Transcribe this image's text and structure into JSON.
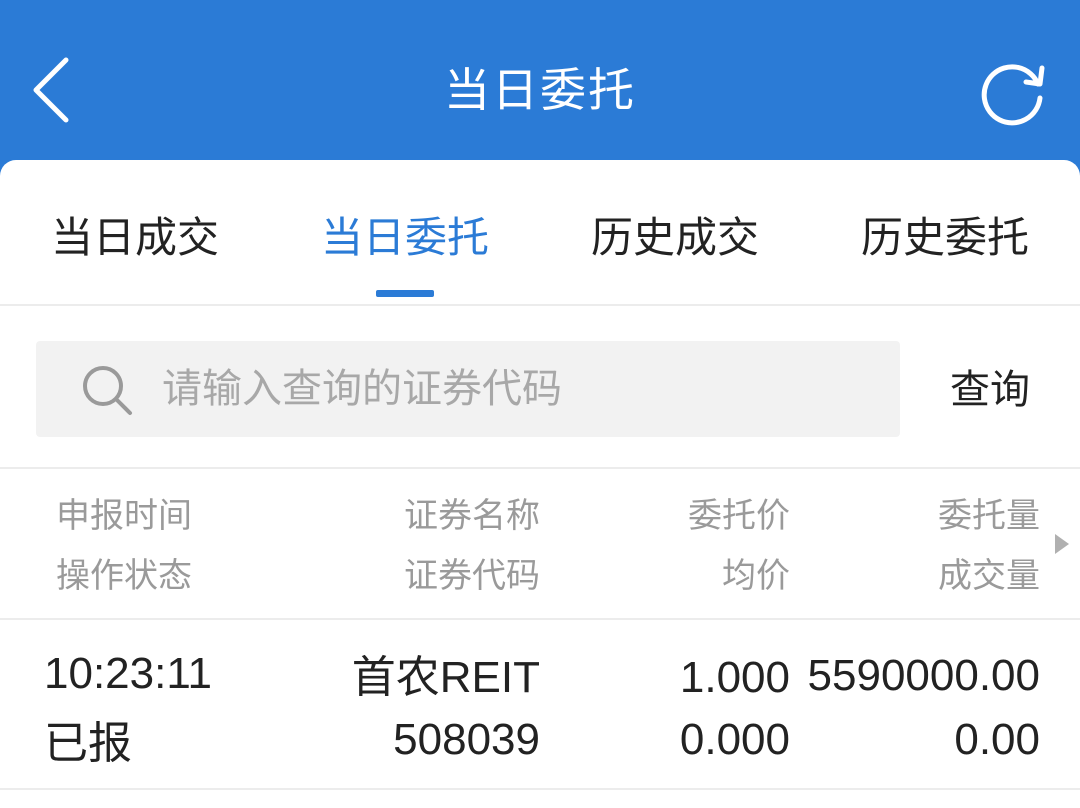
{
  "header": {
    "title": "当日委托",
    "bg_color": "#2b7bd6"
  },
  "icons": {
    "back": "chevron-left-icon",
    "refresh": "refresh-icon",
    "search": "search-icon",
    "more": "triangle-right-icon"
  },
  "tabs": [
    {
      "label": "当日成交",
      "active": false
    },
    {
      "label": "当日委托",
      "active": true
    },
    {
      "label": "历史成交",
      "active": false
    },
    {
      "label": "历史委托",
      "active": false
    }
  ],
  "search": {
    "placeholder": "请输入查询的证券代码",
    "value": "",
    "button_label": "查询"
  },
  "table": {
    "headers": {
      "col1": [
        "申报时间",
        "操作状态"
      ],
      "col2": [
        "证券名称",
        "证券代码"
      ],
      "col3": [
        "委托价",
        "均价"
      ],
      "col4": [
        "委托量",
        "成交量"
      ]
    },
    "rows": [
      {
        "time": "10:23:11",
        "status": "已报",
        "name": "首农REIT",
        "code": "508039",
        "price": "1.000",
        "avg_price": "0.000",
        "volume": "5590000.00",
        "filled": "0.00"
      }
    ]
  },
  "colors": {
    "accent": "#2b7bd6",
    "muted_text": "#9a9a9a"
  }
}
